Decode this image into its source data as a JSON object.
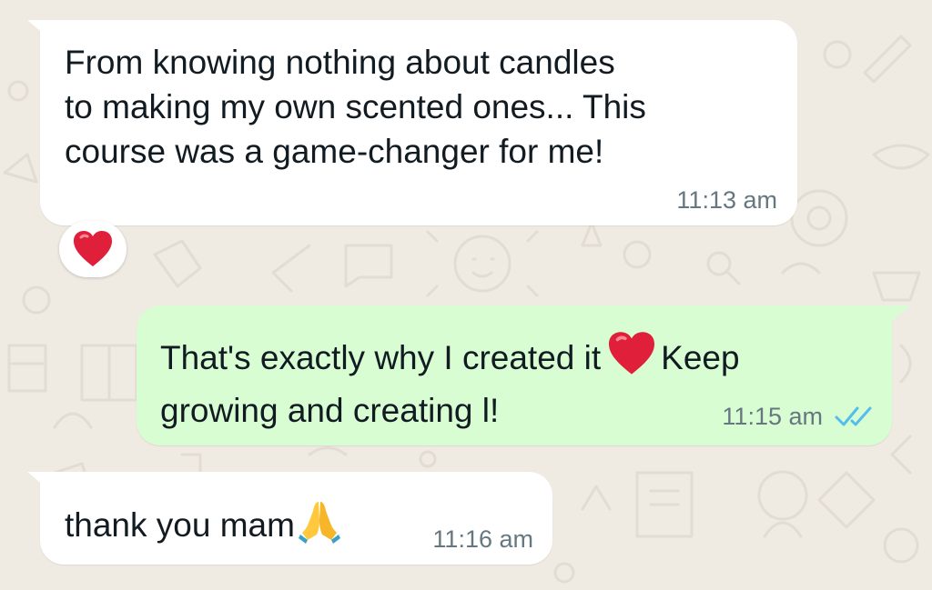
{
  "chat": {
    "messages": [
      {
        "direction": "incoming",
        "text": "From knowing nothing about candles\nto making my own scented ones... This\ncourse was a game-changer for me!",
        "time": "11:13 am",
        "reaction": "red-heart"
      },
      {
        "direction": "outgoing",
        "text_before_emoji": "That's exactly why I created it",
        "emoji": "red-heart",
        "text_after_emoji": "Keep growing and creating l!",
        "time": "11:15 am",
        "status": "read-double-tick"
      },
      {
        "direction": "incoming",
        "text": "thank you mam",
        "emoji": "folded-hands",
        "time": "11:16 am"
      }
    ]
  },
  "colors": {
    "wallpaper": "#efeae2",
    "incoming_bubble": "#ffffff",
    "outgoing_bubble": "#d9fdd3",
    "timestamp": "#667781",
    "read_ticks": "#53bdeb",
    "heart": "#e0203a"
  }
}
